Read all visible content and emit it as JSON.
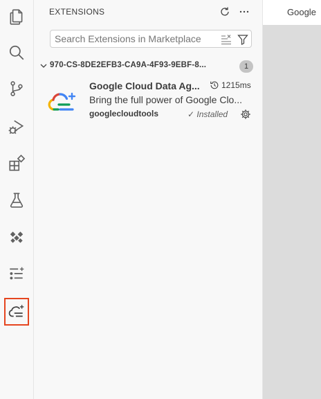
{
  "activity_bar": {
    "items": [
      {
        "name": "explorer-icon"
      },
      {
        "name": "search-icon"
      },
      {
        "name": "source-control-icon"
      },
      {
        "name": "run-debug-icon"
      },
      {
        "name": "extensions-icon"
      },
      {
        "name": "testing-icon"
      },
      {
        "name": "dataflow-icon"
      },
      {
        "name": "sparkle-list-icon"
      },
      {
        "name": "google-cloud-agent-icon",
        "highlighted": true
      }
    ],
    "highlight_color": "#e5451f"
  },
  "sidebar": {
    "title": "EXTENSIONS",
    "actions": [
      "refresh-icon",
      "more-actions-icon"
    ],
    "search": {
      "placeholder": "Search Extensions in Marketplace",
      "value": "",
      "actions": [
        "clear-filter-icon",
        "filter-icon"
      ]
    },
    "section": {
      "title": "970-CS-8DE2EFB3-CA9A-4F93-9EBF-8...",
      "count": "1",
      "expanded": true
    },
    "extension": {
      "name": "Google Cloud Data Ag...",
      "timing": "1215ms",
      "description": "Bring the full power of Google Clo...",
      "publisher": "googlecloudtools",
      "status": "✓ Installed",
      "icon": "google-cloud-sparkle-icon"
    }
  },
  "editor": {
    "tab_label": "Google"
  }
}
